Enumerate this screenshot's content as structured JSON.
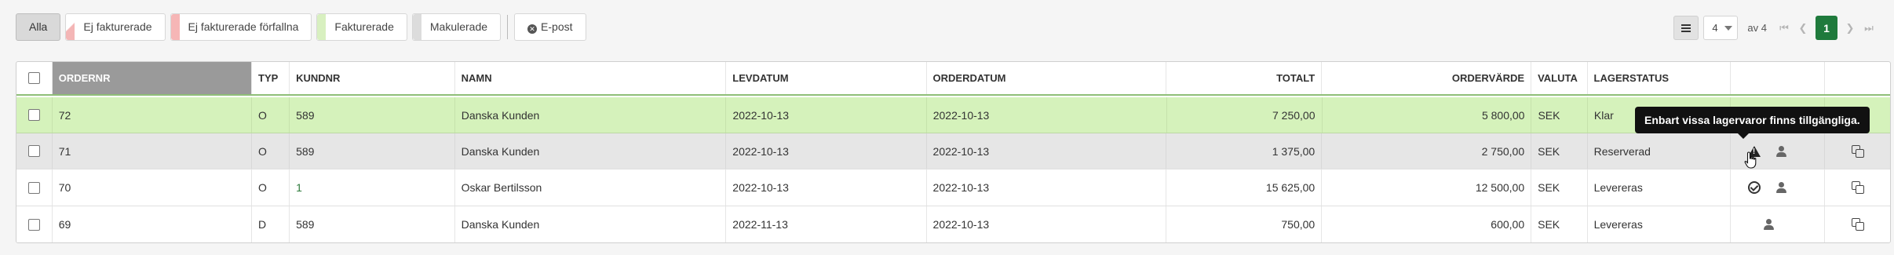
{
  "filters": {
    "all": "Alla",
    "not_invoiced": "Ej fakturerade",
    "not_invoiced_overdue": "Ej fakturerade förfallna",
    "invoiced": "Fakturerade",
    "voided": "Makulerade",
    "email": "E-post"
  },
  "pager": {
    "per_page": "4",
    "of_total": "av 4",
    "current_page": "1",
    "accent_color": "#1f7a3c"
  },
  "columns": {
    "ordernr": "ORDERNR",
    "typ": "TYP",
    "kundnr": "KUNDNR",
    "namn": "NAMN",
    "levdatum": "LEVDATUM",
    "orderdatum": "ORDERDATUM",
    "totalt": "TOTALT",
    "ordervarde": "ORDERVÄRDE",
    "valuta": "VALUTA",
    "lagerstatus": "LAGERSTATUS"
  },
  "rows": [
    {
      "ordernr": "72",
      "typ": "O",
      "kundnr": "589",
      "namn": "Danska Kunden",
      "levdatum": "2022-10-13",
      "orderdatum": "2022-10-13",
      "totalt": "7 250,00",
      "ordervarde": "5 800,00",
      "valuta": "SEK",
      "lagerstatus": "Klar",
      "status_color": "#d5f2bb"
    },
    {
      "ordernr": "71",
      "typ": "O",
      "kundnr": "589",
      "namn": "Danska Kunden",
      "levdatum": "2022-10-13",
      "orderdatum": "2022-10-13",
      "totalt": "1 375,00",
      "ordervarde": "2 750,00",
      "valuta": "SEK",
      "lagerstatus": "Reserverad",
      "status_icon": "warning-icon"
    },
    {
      "ordernr": "70",
      "typ": "O",
      "kundnr": "1",
      "namn": "Oskar Bertilsson",
      "levdatum": "2022-10-13",
      "orderdatum": "2022-10-13",
      "totalt": "15 625,00",
      "ordervarde": "12 500,00",
      "valuta": "SEK",
      "lagerstatus": "Levereras",
      "status_icon": "check-circle-icon"
    },
    {
      "ordernr": "69",
      "typ": "D",
      "kundnr": "589",
      "namn": "Danska Kunden",
      "levdatum": "2022-11-13",
      "orderdatum": "2022-10-13",
      "totalt": "750,00",
      "ordervarde": "600,00",
      "valuta": "SEK",
      "lagerstatus": "Levereras"
    }
  ],
  "tooltip": {
    "text": "Enbart vissa lagervaror finns tillgängliga."
  }
}
